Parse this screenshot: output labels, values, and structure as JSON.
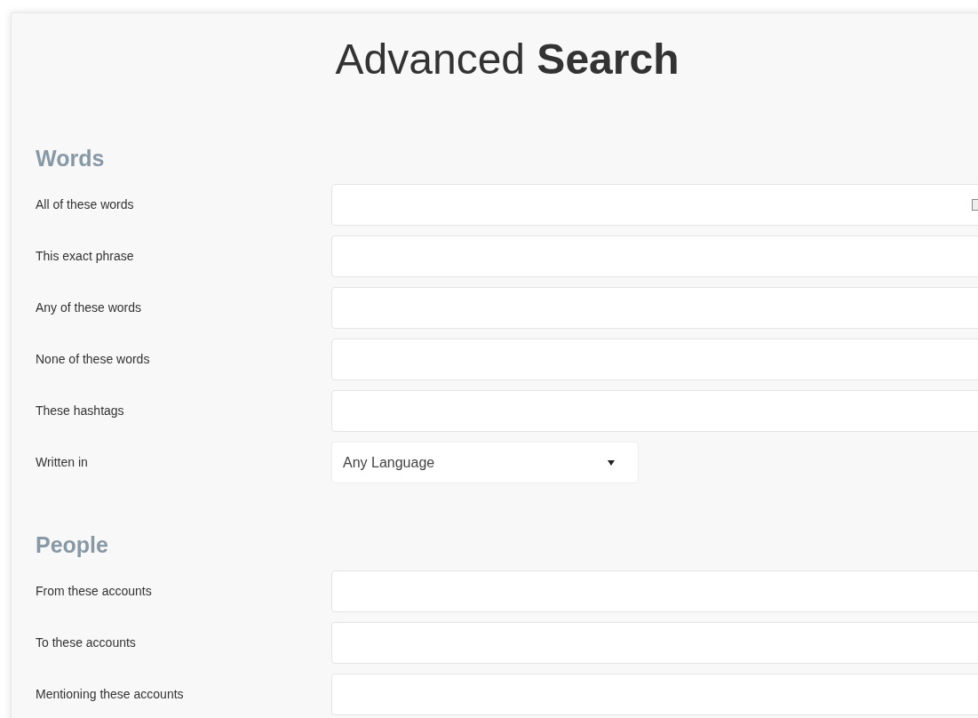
{
  "title": "Advanced **Search**",
  "sections": [
    {
      "heading": "Words",
      "fields": [
        {
          "kind": "text",
          "label": "All of these words"
        },
        {
          "kind": "text",
          "label": "This exact phrase"
        },
        {
          "kind": "text",
          "label": "Any of these words"
        },
        {
          "kind": "text",
          "label": "None of these words"
        },
        {
          "kind": "text",
          "label": "These hashtags"
        },
        {
          "kind": "select",
          "label": "Written in",
          "value": "Any Language"
        }
      ]
    },
    {
      "heading": "People",
      "fields": [
        {
          "kind": "text",
          "label": "From these accounts"
        },
        {
          "kind": "text",
          "label": "To these accounts"
        },
        {
          "kind": "text",
          "label": "Mentioning these accounts"
        }
      ]
    }
  ]
}
